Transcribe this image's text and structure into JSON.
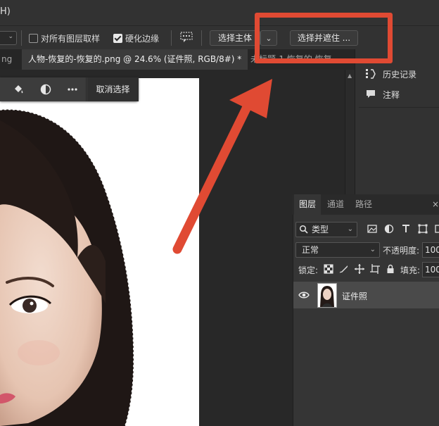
{
  "menubar": {
    "fragment": "H)"
  },
  "options": {
    "sample_all_layers": {
      "label": "对所有图层取样",
      "checked": false
    },
    "hard_edge": {
      "label": "硬化边缘",
      "checked": true
    },
    "select_subject": "选择主体",
    "select_and_mask": "选择并遮住 ..."
  },
  "tabs": {
    "partial_left": "ng",
    "active": "人物-恢复的-恢复的.png @ 24.6% (证件照, RGB/8#) *",
    "close": "×",
    "partial_right": "未标题-1 恢复的 恢复"
  },
  "context_bar": {
    "deselect": "取消选择"
  },
  "right_panel": {
    "history": "历史记录",
    "notes": "注释"
  },
  "layers_panel": {
    "tabs": [
      "图层",
      "通道",
      "路径"
    ],
    "filter_kind": "类型",
    "blend_mode": "正常",
    "opacity_label": "不透明度:",
    "opacity_value": "100",
    "lock_label": "锁定:",
    "fill_label": "填充:",
    "fill_value": "100",
    "layer_name": "证件照"
  },
  "colors": {
    "annotation": "#e04a33"
  }
}
